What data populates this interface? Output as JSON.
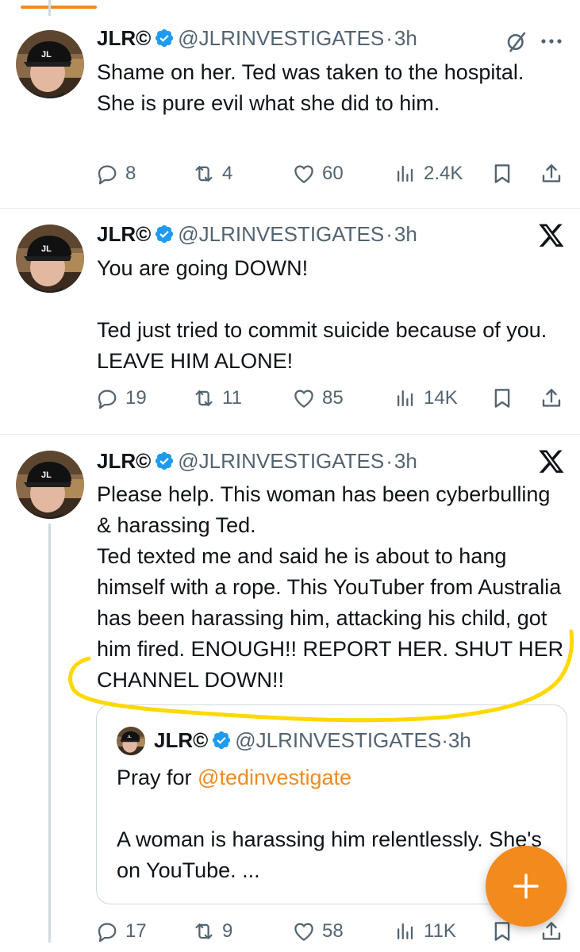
{
  "theme": {
    "accent": "#f28a1e",
    "verified_color": "#1d9bf0",
    "secondary_text": "#536471",
    "highlight": "#ffd800"
  },
  "tweets": [
    {
      "author_name": "JLR©",
      "handle": "@JLRINVESTIGATES",
      "separator": "·",
      "time": "3h",
      "text": "Shame on her. Ted was taken to the hospital. She is pure evil what she did to him.",
      "replies": "8",
      "reposts": "4",
      "likes": "60",
      "views": "2.4K",
      "corner_icons": [
        "grok-icon",
        "more-icon"
      ]
    },
    {
      "author_name": "JLR©",
      "handle": "@JLRINVESTIGATES",
      "separator": "·",
      "time": "3h",
      "text": "You are going DOWN!\n\nTed just tried to commit suicide because of you. LEAVE HIM ALONE!",
      "replies": "19",
      "reposts": "11",
      "likes": "85",
      "views": "14K",
      "corner_icons": [
        "x-logo-icon"
      ]
    },
    {
      "author_name": "JLR©",
      "handle": "@JLRINVESTIGATES",
      "separator": "·",
      "time": "3h",
      "text": "Please help. This woman has been cyberbulling & harassing Ted.\nTed texted me and said he is about to hang himself with a rope. This YouTuber from Australia has been harassing him, attacking his child, got him fired. ENOUGH!! REPORT HER. SHUT HER CHANNEL DOWN!!",
      "replies": "17",
      "reposts": "9",
      "likes": "58",
      "views": "11K",
      "corner_icons": [
        "x-logo-icon"
      ],
      "quote": {
        "author_name": "JLR©",
        "handle": "@JLRINVESTIGATES",
        "separator": "·",
        "time": "3h",
        "text_prefix": "Pray for ",
        "mention": "@tedinvestigate",
        "text_rest": "\n\nA woman is harassing him relentlessly. She's on YouTube. ..."
      }
    }
  ],
  "fab": {
    "icon": "plus-icon"
  }
}
